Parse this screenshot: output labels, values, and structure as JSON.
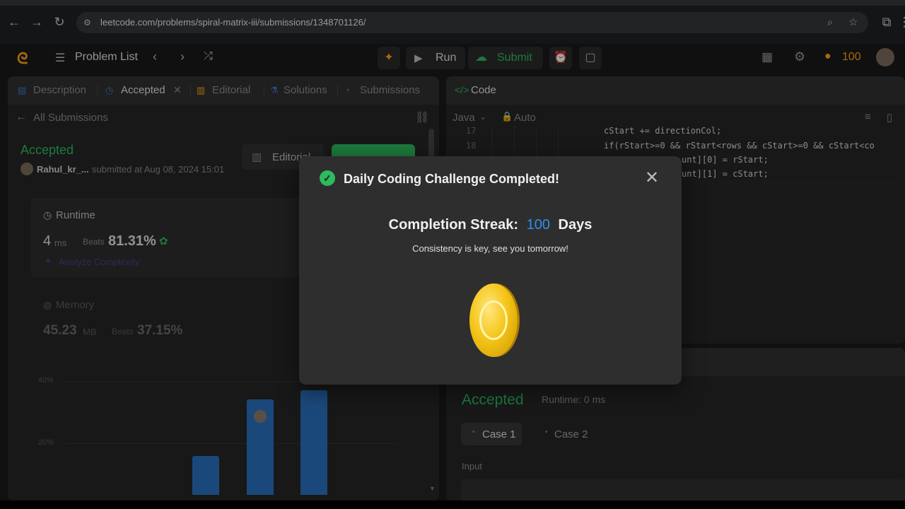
{
  "browser": {
    "url": "leetcode.com/problems/spiral-matrix-iii/submissions/1348701126/"
  },
  "toolbar": {
    "problem_list": "Problem List",
    "run": "Run",
    "submit": "Submit",
    "streak_count": "100"
  },
  "left_panel": {
    "tabs": [
      "Description",
      "Accepted",
      "Editorial",
      "Solutions",
      "Submissions"
    ],
    "back_label": "All Submissions",
    "status": "Accepted",
    "user": "Rahul_kr_...",
    "submitted_at": "submitted at Aug 08, 2024 15:01",
    "editorial_btn": "Editorial",
    "runtime_title": "Runtime",
    "runtime_value": "4",
    "runtime_unit": "ms",
    "runtime_beats_label": "Beats",
    "runtime_beats": "81.31%",
    "analyze": "Analyze Complexity",
    "memory_title": "Memory",
    "memory_value": "45.23",
    "memory_unit": "MB",
    "memory_beats_label": "Beats",
    "memory_beats": "37.15%",
    "axis_40": "40%",
    "axis_20": "20%"
  },
  "chart_data": {
    "type": "bar",
    "values_percent": [
      16,
      34,
      37
    ],
    "ylim": [
      0,
      45
    ]
  },
  "code_panel": {
    "title": "Code",
    "language": "Java",
    "auto": "Auto",
    "line_17": "17",
    "line_18": "18",
    "code_17": "cStart += directionCol;",
    "code_18": "if(rStart>=0 && rStart<rows && cStart>=0 && cStart<co",
    "code_19": "unt][0] = rStart;",
    "code_20": "unt][1] = cStart;"
  },
  "result_panel": {
    "status": "Accepted",
    "runtime": "Runtime: 0 ms",
    "case1": "Case 1",
    "case2": "Case 2",
    "input_label": "Input"
  },
  "modal": {
    "title": "Daily Coding Challenge Completed!",
    "streak_label": "Completion Streak:",
    "streak_value": "100",
    "streak_unit": "Days",
    "message": "Consistency is key, see you tomorrow!"
  },
  "colors": {
    "accent_green": "#2cbb5d",
    "streak_blue": "#2e8ef0",
    "coin_gold": "#f5c518"
  }
}
